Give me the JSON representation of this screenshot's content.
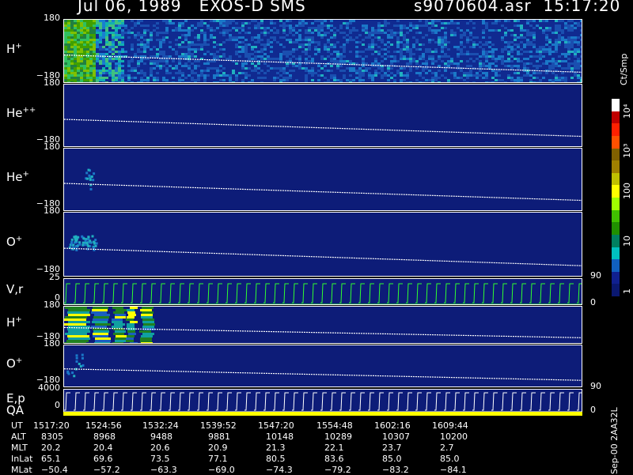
{
  "header": {
    "date": "Jul 06, 1989   EXOS-D SMS",
    "file": "s9070604.asr  15:17:20"
  },
  "panels": [
    {
      "label": "H",
      "sup": "+",
      "top_tick": "180",
      "bottom_tick": "−180",
      "mode": "active"
    },
    {
      "label": "He",
      "sup": "++",
      "top_tick": "180",
      "bottom_tick": "−180",
      "mode": "empty"
    },
    {
      "label": "He",
      "sup": "+",
      "top_tick": "180",
      "bottom_tick": "−180",
      "mode": "spot"
    },
    {
      "label": "O",
      "sup": "+",
      "top_tick": "180",
      "bottom_tick": "−180",
      "mode": "blob"
    },
    {
      "label": "V,r",
      "sup": "",
      "top_tick": "25",
      "bottom_tick": "0",
      "mode": "sweep",
      "right_top": "90",
      "right_bottom": "0"
    },
    {
      "label": "H",
      "sup": "+",
      "top_tick": "180",
      "bottom_tick": "−180",
      "mode": "bars"
    },
    {
      "label": "O",
      "sup": "+",
      "top_tick": "180",
      "bottom_tick": "−180",
      "mode": "small"
    },
    {
      "label": "E,p",
      "sup": "",
      "top_tick": "4000",
      "bottom_tick": "0",
      "mode": "sweepwhite",
      "right_top": "90",
      "right_bottom": "0"
    }
  ],
  "qa_label": "QA",
  "footer": {
    "rows": [
      {
        "name": "UT",
        "values": [
          "1517:20",
          "1524:56",
          "1532:24",
          "1539:52",
          "1547:20",
          "1554:48",
          "1602:16",
          "1609:44"
        ]
      },
      {
        "name": "ALT",
        "values": [
          "8305",
          "8968",
          "9488",
          "9881",
          "10148",
          "10289",
          "10307",
          "10200"
        ]
      },
      {
        "name": "MLT",
        "values": [
          "20.2",
          "20.4",
          "20.6",
          "20.9",
          "21.3",
          "22.1",
          "23.7",
          "2.7"
        ]
      },
      {
        "name": "InLat",
        "values": [
          "65.1",
          "69.6",
          "73.5",
          "77.1",
          "80.5",
          "83.6",
          "85.0",
          "85.0"
        ]
      },
      {
        "name": "MLat",
        "values": [
          "−50.4",
          "−57.2",
          "−63.3",
          "−69.0",
          "−74.3",
          "−79.2",
          "−83.2",
          "−84.1"
        ]
      }
    ],
    "side_note": "Sep-00  2AA32L"
  },
  "colorbar": {
    "unit": "Ct/Smp",
    "labels": [
      "10⁴",
      "10³",
      "100",
      "10",
      "1"
    ],
    "colors": [
      "#ffffff",
      "#c00000",
      "#ff2000",
      "#ff5000",
      "#806000",
      "#a08000",
      "#c0c000",
      "#ffff00",
      "#a0ff00",
      "#40c000",
      "#209000",
      "#008060",
      "#00c0c0",
      "#1060c0",
      "#102090",
      "#0a1870"
    ]
  },
  "chart_data": {
    "type": "heatmap",
    "title": "Jul 06, 1989   EXOS-D SMS",
    "subtitle": "s9070604.asr  15:17:20",
    "x_ticks": [
      "1517:20",
      "1524:56",
      "1532:24",
      "1539:52",
      "1547:20",
      "1554:48",
      "1602:16",
      "1609:44"
    ],
    "panels": [
      "H+",
      "He++",
      "He+",
      "O+",
      "V,r",
      "H+",
      "O+",
      "E,p"
    ],
    "colorbar_unit": "Ct/Smp",
    "colorbar_range": [
      1,
      10000
    ]
  }
}
